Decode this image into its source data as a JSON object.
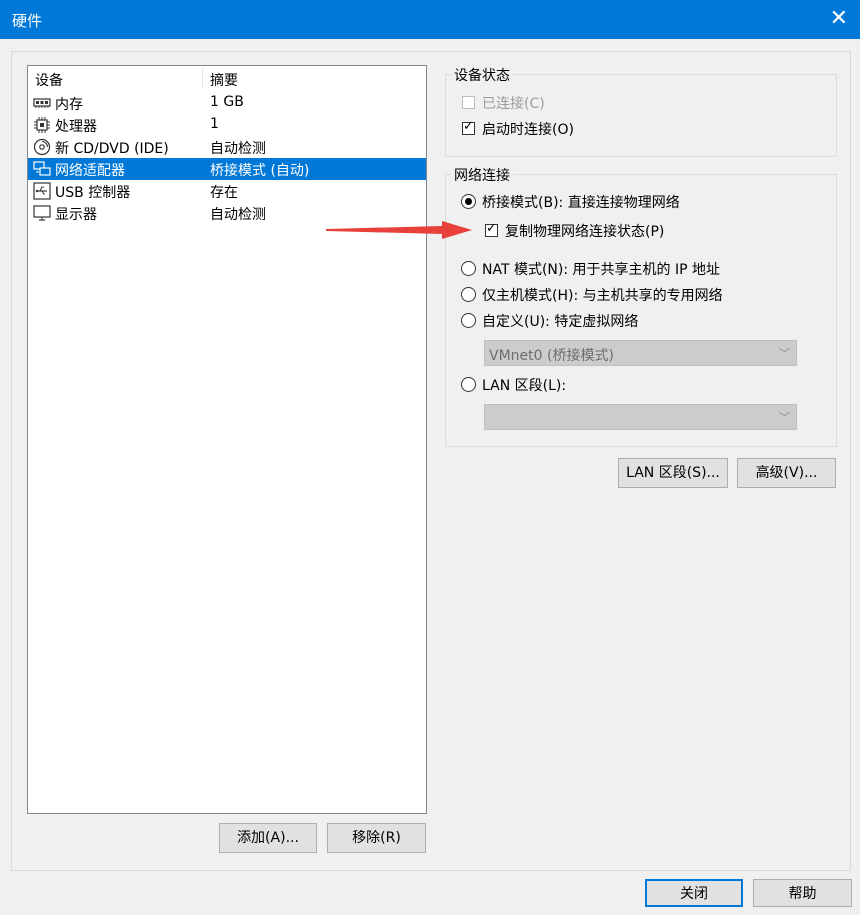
{
  "window": {
    "title": "硬件",
    "close_glyph": "✕"
  },
  "device_list": {
    "col_device": "设备",
    "col_summary": "摘要",
    "items": [
      {
        "name": "内存",
        "summary": "1 GB",
        "icon": "memory-icon"
      },
      {
        "name": "处理器",
        "summary": "1",
        "icon": "cpu-icon"
      },
      {
        "name": "新 CD/DVD (IDE)",
        "summary": "自动检测",
        "icon": "cd-dvd-icon"
      },
      {
        "name": "网络适配器",
        "summary": "桥接模式 (自动)",
        "icon": "network-adapter-icon",
        "selected": true
      },
      {
        "name": "USB 控制器",
        "summary": "存在",
        "icon": "usb-icon"
      },
      {
        "name": "显示器",
        "summary": "自动检测",
        "icon": "display-icon"
      }
    ]
  },
  "buttons": {
    "add": "添加(A)...",
    "remove": "移除(R)",
    "close": "关闭",
    "help": "帮助",
    "lan_segments": "LAN 区段(S)...",
    "advanced": "高级(V)..."
  },
  "device_status": {
    "title": "设备状态",
    "connected": {
      "label": "已连接(C)",
      "checked": false,
      "disabled": true
    },
    "connect_at_power_on": {
      "label": "启动时连接(O)",
      "checked": true
    }
  },
  "network_connection": {
    "title": "网络连接",
    "bridged": {
      "label": "桥接模式(B): 直接连接物理网络",
      "selected": true
    },
    "replicate_state": {
      "label": "复制物理网络连接状态(P)",
      "checked": true
    },
    "nat": {
      "label": "NAT 模式(N): 用于共享主机的 IP 地址",
      "selected": false
    },
    "host_only": {
      "label": "仅主机模式(H): 与主机共享的专用网络",
      "selected": false
    },
    "custom": {
      "label": "自定义(U): 特定虚拟网络",
      "selected": false
    },
    "custom_value": "VMnet0 (桥接模式)",
    "lan_segment": {
      "label": "LAN 区段(L):",
      "selected": false
    },
    "lan_segment_value": ""
  },
  "colors": {
    "accent": "#0078d7",
    "annotation_arrow": "#e8403a"
  }
}
